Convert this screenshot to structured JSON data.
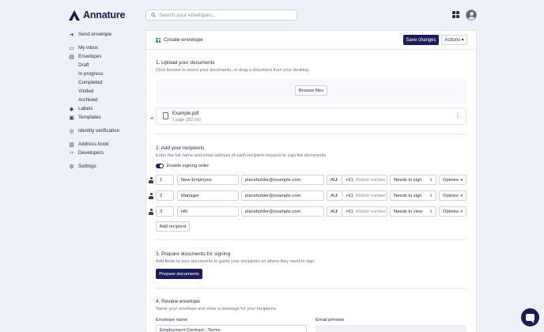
{
  "app": {
    "logo_text": "Annature"
  },
  "search": {
    "placeholder": "Search your envelopes..."
  },
  "sidebar": {
    "items": [
      {
        "label": "Send envelope",
        "icon": "send-icon"
      },
      {
        "label": "My inbox",
        "icon": "inbox-icon"
      },
      {
        "label": "Envelopes",
        "icon": "envelopes-icon"
      },
      {
        "label": "Draft"
      },
      {
        "label": "In progress"
      },
      {
        "label": "Completed"
      },
      {
        "label": "Voided"
      },
      {
        "label": "Archived"
      },
      {
        "label": "Labels",
        "icon": "label-icon"
      },
      {
        "label": "Templates",
        "icon": "templates-icon"
      },
      {
        "label": "Identity verification",
        "icon": "fingerprint-icon"
      },
      {
        "label": "Address book",
        "icon": "address-book-icon"
      },
      {
        "label": "Developers",
        "icon": "code-icon"
      },
      {
        "label": "Settings",
        "icon": "settings-icon"
      }
    ]
  },
  "header": {
    "title": "Create envelope",
    "save_label": "Save changes",
    "actions_label": "Actions"
  },
  "upload": {
    "title": "1. Upload your documents",
    "desc": "Click browse to select your documents, or drag a document from your desktop.",
    "browse_label": "Browse files",
    "file": {
      "name": "Example.pdf",
      "meta": "1 page (282 Kb)"
    }
  },
  "recipients": {
    "title": "2. Add your recipients",
    "desc": "Enter the full name and email address of each recipient required to sign the documents.",
    "signing_order_label": "Enable signing order",
    "rows": [
      {
        "order": "1",
        "name": "New Employee",
        "email": "placeholder@example.com",
        "country": "AU",
        "prefix": "+61",
        "mobile_placeholder": "Mobile number",
        "action": "Needs to sign",
        "options": "Options"
      },
      {
        "order": "2",
        "name": "Manager",
        "email": "placeholder@example.com",
        "country": "AU",
        "prefix": "+61",
        "mobile_placeholder": "Mobile number",
        "action": "Needs to sign",
        "options": "Options"
      },
      {
        "order": "3",
        "name": "HR",
        "email": "placeholder@example.com",
        "country": "AU",
        "prefix": "+61",
        "mobile_placeholder": "Mobile number",
        "action": "Needs to view",
        "options": "Options"
      }
    ],
    "add_label": "Add recipient"
  },
  "prepare": {
    "title": "3. Prepare documents for signing",
    "desc": "Add fields to your documents to guide your recipients on where they need to sign.",
    "button_label": "Prepare documents"
  },
  "review": {
    "title": "4. Review envelope",
    "desc": "Name your envelope and enter a message for your recipients.",
    "name_label": "Envelope name",
    "name_value": "Employment Contract - Terms",
    "preview_label": "Email preview"
  },
  "colors": {
    "brand": "#1b1b5b",
    "accent_green": "#23a455",
    "background": "#eef1f7"
  }
}
